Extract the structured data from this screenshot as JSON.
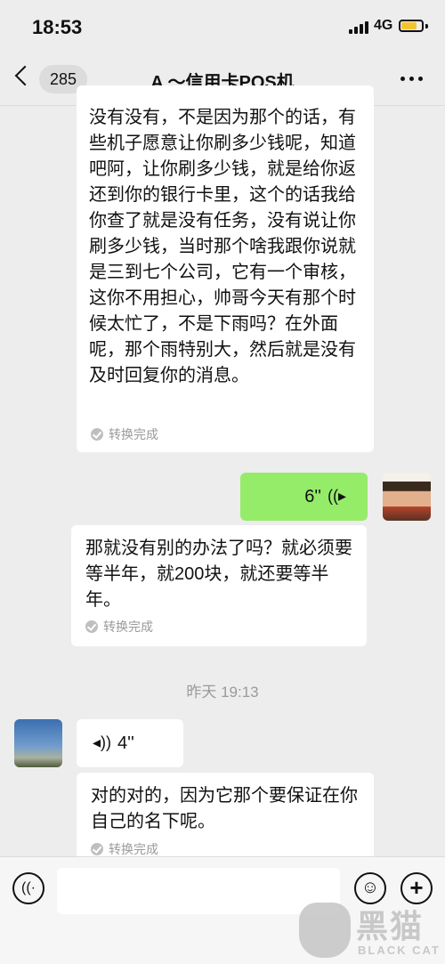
{
  "status_bar": {
    "time": "18:53",
    "network": "4G"
  },
  "nav": {
    "unread_count": "285",
    "title": "A ～信用卡POS机"
  },
  "messages": [
    {
      "side": "left",
      "type": "text",
      "text": "没有没有，不是因为那个的话，有些机子愿意让你刷多少钱呢，知道吧阿，让你刷多少钱，就是给你返还到你的银行卡里，这个的话我给你查了就是没有任务，没有说让你刷多少钱，当时那个啥我跟你说就是三到七个公司，它有一个审核，这你不用担心，帅哥今天有那个时候太忙了，不是下雨吗？在外面呢，那个雨特别大，然后就是没有及时回复你的消息。",
      "status": "转换完成"
    },
    {
      "side": "right",
      "type": "voice",
      "duration": "6''"
    },
    {
      "side": "left",
      "type": "text",
      "text": "那就没有别的办法了吗？就必须要等半年，就200块，就还要等半年。",
      "status": "转换完成"
    },
    {
      "type": "time",
      "text": "昨天 19:13"
    },
    {
      "side": "left",
      "type": "voice",
      "duration": "4''"
    },
    {
      "side": "left",
      "type": "text",
      "text": "对的对的，因为它那个要保证在你自己的名下呢。",
      "status": "转换完成"
    }
  ],
  "input_bar": {
    "voice_icon": "voice-icon",
    "emoji_icon": "emoji-icon",
    "plus_icon": "plus-icon"
  },
  "watermark": {
    "cn": "黑猫",
    "en": "BLACK CAT"
  }
}
